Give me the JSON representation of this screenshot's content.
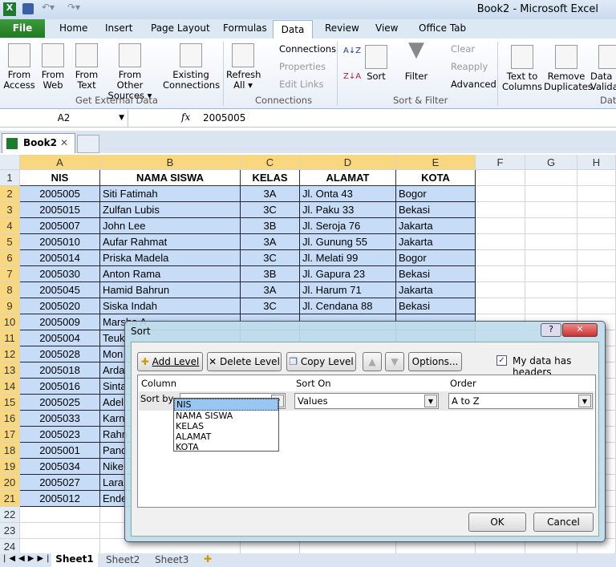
{
  "window": {
    "title": "Book2  -  Microsoft Excel"
  },
  "ribbon_tabs": [
    "File",
    "Home",
    "Insert",
    "Page Layout",
    "Formulas",
    "Data",
    "Review",
    "View",
    "Office Tab"
  ],
  "active_tab": "Data",
  "ribbon": {
    "get_external": {
      "label": "Get External Data",
      "buttons": [
        "From Access",
        "From Web",
        "From Text",
        "From Other Sources ▾",
        "Existing Connections"
      ]
    },
    "connections": {
      "label": "Connections",
      "refresh": "Refresh All ▾",
      "items": [
        "Connections",
        "Properties",
        "Edit Links"
      ]
    },
    "sort_filter": {
      "label": "Sort & Filter",
      "sort": "Sort",
      "filter": "Filter",
      "items": [
        "Clear",
        "Reapply",
        "Advanced"
      ]
    },
    "data_tools": {
      "label": "Data",
      "buttons": [
        "Text to Columns",
        "Remove Duplicates",
        "Data Validation"
      ]
    }
  },
  "formula_bar": {
    "name_box": "A2",
    "fx": "fx",
    "value": "2005005"
  },
  "workbook_tab": "Book2",
  "columns": [
    "A",
    "B",
    "C",
    "D",
    "E",
    "F",
    "G",
    "H"
  ],
  "headers": [
    "NIS",
    "NAMA SISWA",
    "KELAS",
    "ALAMAT",
    "KOTA"
  ],
  "rows": [
    [
      "2005005",
      "Siti Fatimah",
      "3A",
      "Jl. Onta 43",
      "Bogor"
    ],
    [
      "2005015",
      "Zulfan Lubis",
      "3C",
      "Jl. Paku 33",
      "Bekasi"
    ],
    [
      "2005007",
      "John Lee",
      "3B",
      "Jl. Seroja 76",
      "Jakarta"
    ],
    [
      "2005010",
      "Aufar Rahmat",
      "3A",
      "Jl. Gunung 55",
      "Jakarta"
    ],
    [
      "2005014",
      "Priska Madela",
      "3C",
      "Jl. Melati 99",
      "Bogor"
    ],
    [
      "2005030",
      "Anton Rama",
      "3B",
      "Jl. Gapura 23",
      "Bekasi"
    ],
    [
      "2005045",
      "Hamid Bahrun",
      "3A",
      "Jl. Harum 71",
      "Jakarta"
    ],
    [
      "2005020",
      "Siska Indah",
      "3C",
      "Jl. Cendana 88",
      "Bekasi"
    ],
    [
      "2005009",
      "Marsha A",
      "",
      "",
      ""
    ],
    [
      "2005004",
      "Teuk",
      "",
      "",
      ""
    ],
    [
      "2005028",
      "Mon",
      "",
      "",
      ""
    ],
    [
      "2005018",
      "Arda",
      "",
      "",
      ""
    ],
    [
      "2005016",
      "Sinta",
      "",
      "",
      ""
    ],
    [
      "2005025",
      "Adel",
      "",
      "",
      ""
    ],
    [
      "2005033",
      "Karn",
      "",
      "",
      ""
    ],
    [
      "2005023",
      "Rahn",
      "",
      "",
      ""
    ],
    [
      "2005001",
      "Pand",
      "",
      "",
      ""
    ],
    [
      "2005034",
      "Nike",
      "",
      "",
      ""
    ],
    [
      "2005027",
      "Lara",
      "",
      "",
      ""
    ],
    [
      "2005012",
      "Ende",
      "",
      "",
      ""
    ]
  ],
  "row_numbers": [
    "1",
    "2",
    "3",
    "4",
    "5",
    "6",
    "7",
    "8",
    "9",
    "10",
    "11",
    "12",
    "13",
    "14",
    "15",
    "16",
    "17",
    "18",
    "19",
    "20",
    "21",
    "22",
    "23",
    "24"
  ],
  "sheets": [
    "Sheet1",
    "Sheet2",
    "Sheet3"
  ],
  "dialog": {
    "title": "Sort",
    "help": "?",
    "close": "✕",
    "add_level": "Add Level",
    "delete_level": "Delete Level",
    "copy_level": "Copy Level",
    "options": "Options...",
    "headers_checkbox": {
      "label": "My data has headers",
      "checked": true
    },
    "col_column": "Column",
    "col_sort_on": "Sort On",
    "col_order": "Order",
    "sort_by": "Sort by",
    "column_value": "",
    "sort_on_value": "Values",
    "order_value": "A to Z",
    "column_options": [
      "NIS",
      "NAMA SISWA",
      "KELAS",
      "ALAMAT",
      "KOTA"
    ],
    "ok": "OK",
    "cancel": "Cancel"
  },
  "colors": {
    "selection": "#c6dcf7",
    "header_highlight": "#f9d77e",
    "file_tab": "#2a8a2a"
  }
}
